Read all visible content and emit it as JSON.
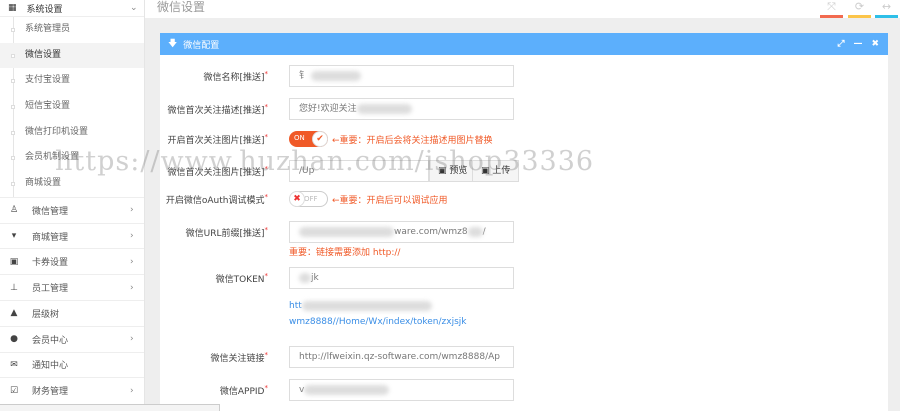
{
  "sidebar": {
    "section": {
      "label": "系统设置",
      "icon": "grid-icon"
    },
    "sub_items": [
      {
        "label": "系统管理员",
        "active": false
      },
      {
        "label": "微信设置",
        "active": true
      },
      {
        "label": "支付宝设置",
        "active": false
      },
      {
        "label": "短信宝设置",
        "active": false
      },
      {
        "label": "微信打印机设置",
        "active": false
      },
      {
        "label": "会员机制设置",
        "active": false
      },
      {
        "label": "商城设置",
        "active": false
      }
    ],
    "items": [
      {
        "label": "微信管理",
        "icon": "penguin-icon",
        "chevron": true
      },
      {
        "label": "商城管理",
        "icon": "cart-icon",
        "chevron": true
      },
      {
        "label": "卡券设置",
        "icon": "money-icon",
        "chevron": true
      },
      {
        "label": "员工管理",
        "icon": "sitemap-icon",
        "chevron": true
      },
      {
        "label": "层级树",
        "icon": "tree-icon",
        "chevron": false
      },
      {
        "label": "会员中心",
        "icon": "user-icon",
        "chevron": true
      },
      {
        "label": "通知中心",
        "icon": "envelope-icon",
        "chevron": false
      },
      {
        "label": "财务管理",
        "icon": "check-square-icon",
        "chevron": true
      }
    ]
  },
  "header": {
    "title": "微信设置",
    "colors": [
      "#f26a4f",
      "#fcc54a",
      "#2ebfe8"
    ]
  },
  "panel": {
    "title": "微信配置",
    "accent": "#5caffc",
    "fields": {
      "name": {
        "label": "微信名称[推送]",
        "value": "钅"
      },
      "desc": {
        "label": "微信首次关注描述[推送]",
        "value": "您好!欢迎关注"
      },
      "img_toggle": {
        "label": "开启首次关注图片[推送]",
        "state": "ON",
        "warn": "←重要：开启后会将关注描述用图片替换"
      },
      "img": {
        "label": "微信首次关注图片[推送]",
        "value": "/Up",
        "preview": "预览",
        "upload": "上传"
      },
      "oauth": {
        "label": "开启微信oAuth调试模式",
        "state": "OFF",
        "warn": "←重要：开启后可以调试应用"
      },
      "url": {
        "label": "微信URL前缀[推送]",
        "value": "ware.com/wmz8",
        "hint": "重要：链接需要添加 http://"
      },
      "token": {
        "label": "微信TOKEN",
        "value": "jk",
        "link_start": "htt",
        "link_end": "wmz8888//Home/Wx/index/token/zxjsjk"
      },
      "follow": {
        "label": "微信关注链接",
        "value": "http://lfweixin.qz-software.com/wmz8888/Ap"
      },
      "appid": {
        "label": "微信APPID",
        "value": "v"
      }
    }
  },
  "watermark": "https://www.huzhan.com/ishop33336"
}
